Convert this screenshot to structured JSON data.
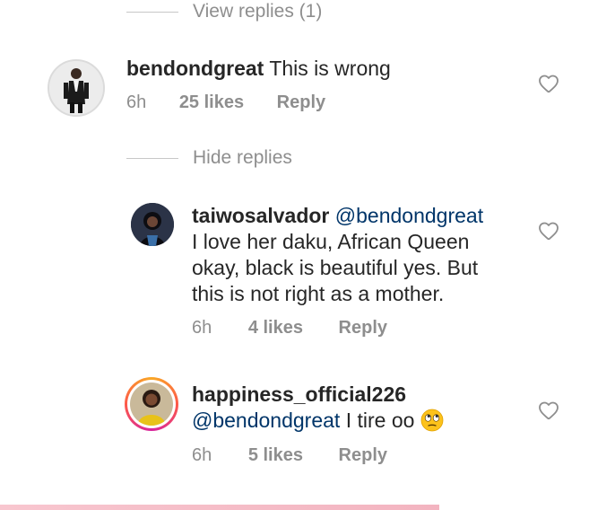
{
  "view_replies_toggle": {
    "label": "View replies (1)"
  },
  "comment_main": {
    "username": "bendondgreat",
    "text": "This is wrong",
    "time": "6h",
    "likes": "25 likes",
    "reply": "Reply",
    "icon": "heart-outline-icon"
  },
  "hide_replies_toggle": {
    "label": "Hide replies"
  },
  "replies": [
    {
      "username": "taiwosalvador",
      "mention": "@bendondgreat",
      "text_line1": "I love her daku, African Queen",
      "text_line2": "okay, black is beautiful yes. But",
      "text_line3": "this is not right as a mother.",
      "time": "6h",
      "likes": "4 likes",
      "reply": "Reply",
      "icon": "heart-outline-icon"
    },
    {
      "username": "happiness_official226",
      "mention": "@bendondgreat",
      "text": "I tire oo",
      "emoji": "face-with-rolling-eyes",
      "time": "6h",
      "likes": "5 likes",
      "reply": "Reply",
      "icon": "heart-outline-icon"
    }
  ],
  "colors": {
    "text": "#262626",
    "muted": "#8e8e8e",
    "mention": "#003569",
    "story_ring_start": "#f9a826",
    "story_ring_end": "#d6249f"
  }
}
